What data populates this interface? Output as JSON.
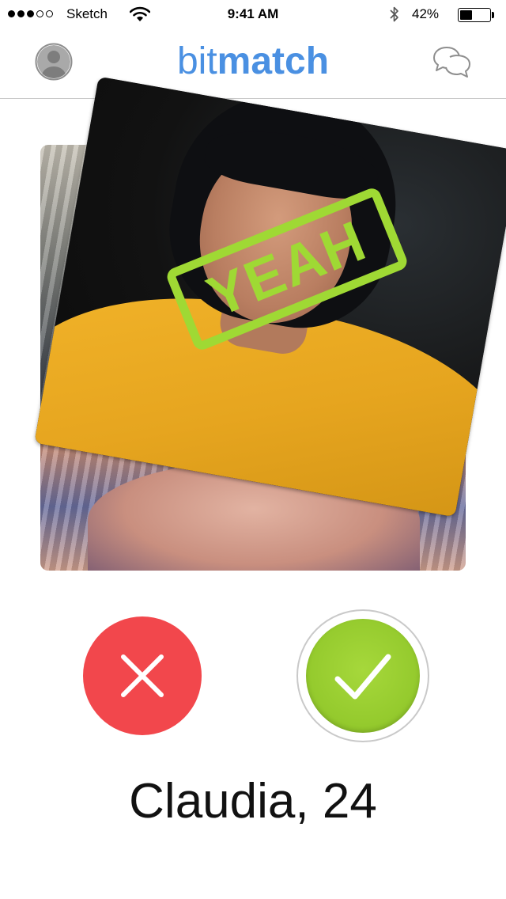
{
  "status_bar": {
    "signal_bars": 5,
    "signal_filled": 3,
    "carrier": "Sketch",
    "time": "9:41 AM",
    "battery_percent": "42%",
    "battery_level": 0.42,
    "icons": [
      "signal-icon",
      "wifi-icon",
      "bluetooth-icon",
      "battery-icon"
    ]
  },
  "nav": {
    "logo_part1": "bit",
    "logo_part2": "match",
    "left_icon": "profile-icon",
    "right_icon": "chat-icon",
    "brand_color": "#4a90e2"
  },
  "card": {
    "stamp_text": "YEAH",
    "stamp_color": "#9fd934"
  },
  "actions": {
    "dislike_icon": "close-icon",
    "like_icon": "checkmark-icon",
    "dislike_color": "#f2474c",
    "like_color": "#93c92c"
  },
  "profile": {
    "name_age": "Claudia, 24"
  }
}
